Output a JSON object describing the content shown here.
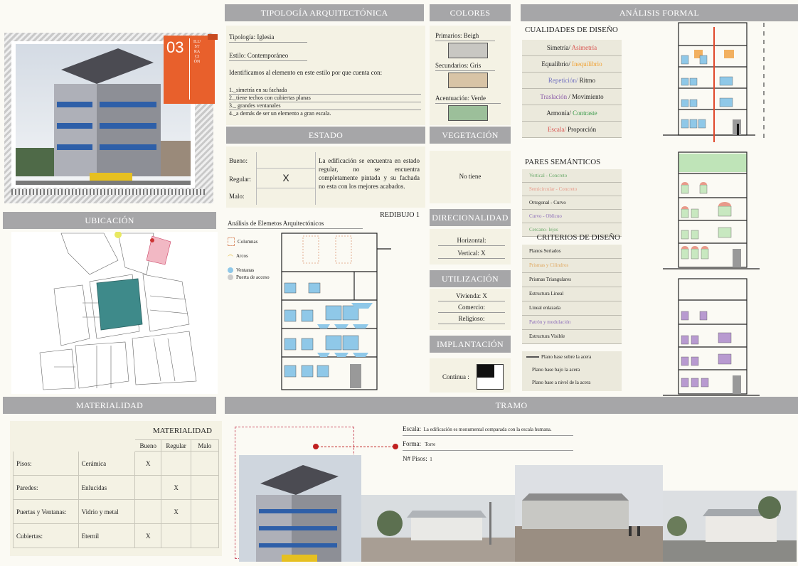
{
  "headers": {
    "tipologia": "TIPOLOGÍA ARQUITECTÓNICA",
    "colores": "COLORES",
    "analisis": "ANÁLISIS FORMAL",
    "estado": "ESTADO",
    "vegetacion": "VEGETACIÓN",
    "ubicacion": "UBICACIÓN",
    "direccionalidad": "DIRECIONALIDAD",
    "utilizacion": "UTILIZACIÓN",
    "implantacion": "IMPLANTACIÓN",
    "materialidad": "MATERIALIDAD",
    "tramo": "TRAMO"
  },
  "badge": {
    "number": "03",
    "vertical": "ILUSTRACIÓN"
  },
  "tipologia": {
    "tipo": "Tipología: Iglesia",
    "estilo": "Estilo: Contemporáneo",
    "intro": "Identificamos al elemento en este estilo por que cuenta con:",
    "items": [
      "1._simetría en su fachada",
      "2._tiene techos con cubiertas planas",
      "3._ grandes ventanales",
      "4._a demás de ser un elemento a gran escala."
    ]
  },
  "colores": {
    "primarios": "Primarios: Beigh",
    "secundarios": "Secundarios: Gris",
    "acentuacion": "Acentuación: Verde",
    "c1": "#c8c7c2",
    "c2": "#d8c4a6",
    "c3": "#9cbf9a"
  },
  "estado": {
    "bueno": "Bueno:",
    "regular": "Regular:",
    "malo": "Malo:",
    "mark": "X",
    "desc": "La edificación se encuentra en estado regular, no se encuentra completamente pintada y su fachada no esta con los mejores acabados."
  },
  "vegetacion": {
    "value": "No tiene"
  },
  "redibujo": {
    "title": "REDIBUJO 1",
    "subtitle": "Análisis de Elemetos Arquitectónicos",
    "legend": [
      "Columnas",
      "Arcos",
      "Ventanas",
      "Puerta de acceso"
    ]
  },
  "direccionalidad": {
    "h": "Horizontal:",
    "v": "Vertical: X"
  },
  "utilizacion": {
    "vivienda": "Vivienda: X",
    "comercio": "Comercio:",
    "religioso": "Religioso:"
  },
  "implantacion": {
    "value": "Continua :"
  },
  "cualidades": {
    "title": "CUALIDADES DE DISEÑO",
    "rows": [
      {
        "a": "Simetría/",
        "b": " Asimetría",
        "ca": "#222",
        "cb": "#d9534f"
      },
      {
        "a": "Equalibrio/",
        "b": " Inequilibrio",
        "ca": "#222",
        "cb": "#f0a030"
      },
      {
        "a": "Repetición/",
        "b": " Ritmo",
        "ca": "#7070c0",
        "cb": "#222"
      },
      {
        "a": "Traslación",
        "b": " / Movimiento",
        "ca": "#8a5aa8",
        "cb": "#222"
      },
      {
        "a": "Armonía/",
        "b": " Contraste",
        "ca": "#222",
        "cb": "#3a9a4a"
      },
      {
        "a": "Escala/",
        "b": " Proporción",
        "ca": "#d9534f",
        "cb": "#222"
      }
    ]
  },
  "pares": {
    "title": "PARES SEMÁNTICOS",
    "rows": [
      {
        "t": "Vertical - Concreto",
        "c": "#6aaa6a"
      },
      {
        "t": "Semicircular - Concreto",
        "c": "#e89a8a"
      },
      {
        "t": "Ortogonal - Curvo",
        "c": "#222"
      },
      {
        "t": "Curvo - Oblicuo",
        "c": "#8a6ab8"
      },
      {
        "t": "Cercano- lejos",
        "c": "#6aaa6a"
      }
    ]
  },
  "criterios": {
    "title": "CRITERIOS DE DISEÑO",
    "rows": [
      {
        "t": "Planos Seriados",
        "c": "#222"
      },
      {
        "t": "Prismas y Cilindros",
        "c": "#e0a860"
      },
      {
        "t": "Prismas Triangulares",
        "c": "#222"
      },
      {
        "t": "Estructura Lineal",
        "c": "#222"
      },
      {
        "t": "Lineal enlazada",
        "c": "#222"
      },
      {
        "t": "Patrón y modulación",
        "c": "#8a6ab8"
      },
      {
        "t": "Estructura Visible",
        "c": "#222"
      }
    ]
  },
  "planos": [
    "Plano base sobre la acera",
    "Plano base bajo la acera",
    "Plano base a nivel de la acera"
  ],
  "materialidad": {
    "title": "MATERIALIDAD",
    "cols": [
      "Bueno",
      "Regular",
      "Malo"
    ],
    "rows": [
      {
        "el": "Pisos:",
        "mat": "Cerámica",
        "b": "X",
        "r": "",
        "m": ""
      },
      {
        "el": "Paredes:",
        "mat": "Enlucidas",
        "b": "",
        "r": "X",
        "m": ""
      },
      {
        "el": "Puertas y Ventanas:",
        "mat": "Vidrio y metal",
        "b": "",
        "r": "X",
        "m": ""
      },
      {
        "el": "Cubiertas:",
        "mat": "Eternil",
        "b": "X",
        "r": "",
        "m": ""
      }
    ]
  },
  "tramo": {
    "escala": "Escala:",
    "escala_txt": "La edificación es monumental comparada con la escala humana.",
    "forma": "Forma:",
    "forma_txt": "Torre",
    "pisos": "N# Pisos:",
    "pisos_txt": "1"
  }
}
